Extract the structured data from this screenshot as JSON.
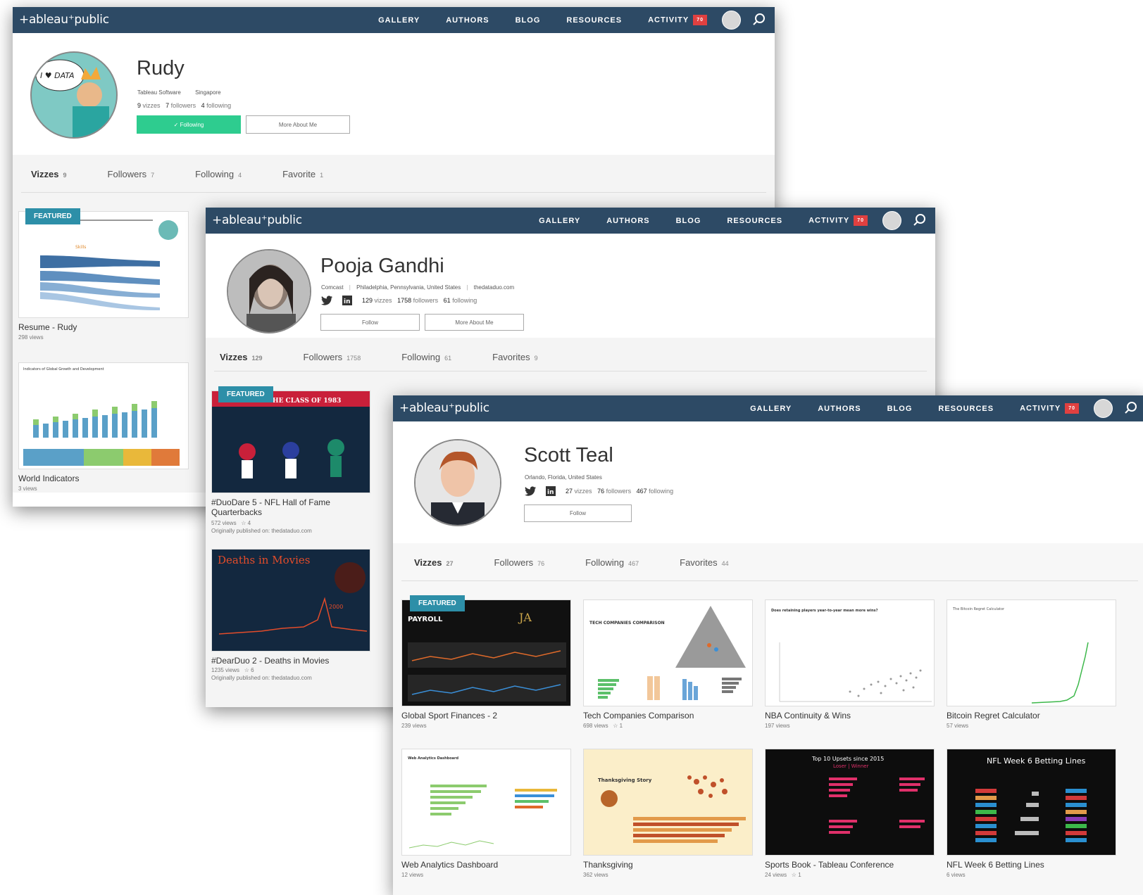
{
  "nav": {
    "logo": "+ableau⁺public",
    "links": [
      "GALLERY",
      "AUTHORS",
      "BLOG",
      "RESOURCES",
      "ACTIVITY"
    ],
    "badge": "70"
  },
  "windows": [
    {
      "profile": {
        "name": "Rudy",
        "org": "Tableau Software",
        "location": "Singapore",
        "vizzes_count": "9",
        "vizzes_label": "vizzes",
        "followers_count": "7",
        "followers_label": "followers",
        "following_count": "4",
        "following_label": "following",
        "follow_btn": "✓ Following",
        "more_btn": "More About Me"
      },
      "tabs": [
        {
          "label": "Vizzes",
          "count": "9"
        },
        {
          "label": "Followers",
          "count": "7"
        },
        {
          "label": "Following",
          "count": "4"
        },
        {
          "label": "Favorite",
          "count": "1"
        }
      ],
      "featured": "FEATURED",
      "cards": [
        {
          "title": "Resume - Rudy",
          "views": "298 views",
          "thumb_text": "Skills"
        },
        {
          "title": "World Indicators",
          "views": "3 views",
          "thumb_text": "Indicators of Global Growth and Development"
        }
      ]
    },
    {
      "profile": {
        "name": "Pooja Gandhi",
        "org": "Comcast",
        "location": "Philadelphia, Pennsylvania, United States",
        "website": "thedataduo.com",
        "vizzes_count": "129",
        "vizzes_label": "vizzes",
        "followers_count": "1758",
        "followers_label": "followers",
        "following_count": "61",
        "following_label": "following",
        "follow_btn": "Follow",
        "more_btn": "More About Me"
      },
      "tabs": [
        {
          "label": "Vizzes",
          "count": "129"
        },
        {
          "label": "Followers",
          "count": "1758"
        },
        {
          "label": "Following",
          "count": "61"
        },
        {
          "label": "Favorites",
          "count": "9"
        }
      ],
      "featured": "FEATURED",
      "cards": [
        {
          "title": "#DuoDare 5 - NFL Hall of Fame Quarterbacks",
          "title_line1": "#DuoDare 5 - NFL Hall of Fame",
          "title_line2": "Quarterbacks",
          "views": "572 views",
          "stars": "4",
          "orig": "Originally published on: thedataduo.com",
          "thumb_text": "OF THE CLASS OF 1983"
        },
        {
          "title": "#DearDuo 2 - Deaths in Movies",
          "views": "1235 views",
          "stars": "6",
          "orig": "Originally published on: thedataduo.com",
          "thumb_text": "Deaths in Movies",
          "thumb_num": "2000"
        }
      ]
    },
    {
      "profile": {
        "name": "Scott Teal",
        "location": "Orlando, Florida, United States",
        "vizzes_count": "27",
        "vizzes_label": "vizzes",
        "followers_count": "76",
        "followers_label": "followers",
        "following_count": "467",
        "following_label": "following",
        "follow_btn": "Follow"
      },
      "tabs": [
        {
          "label": "Vizzes",
          "count": "27"
        },
        {
          "label": "Followers",
          "count": "76"
        },
        {
          "label": "Following",
          "count": "467"
        },
        {
          "label": "Favorites",
          "count": "44"
        }
      ],
      "featured": "FEATURED",
      "cards": [
        {
          "title": "Global Sport Finances - 2",
          "views": "239 views",
          "thumb_text": "PAYROLL"
        },
        {
          "title": "Tech Companies Comparison",
          "views": "698 views",
          "stars": "1",
          "thumb_text": "TECH COMPANIES COMPARISON"
        },
        {
          "title": "NBA Continuity & Wins",
          "views": "197 views",
          "thumb_text": "Does retaining players year-to-year mean more wins?"
        },
        {
          "title": "Bitcoin Regret Calculator",
          "views": "57 views",
          "thumb_text": "The Bitcoin Regret Calculator"
        },
        {
          "title": "Web Analytics Dashboard",
          "views": "12 views",
          "thumb_text": "Web Analytics Dashboard"
        },
        {
          "title": "Thanksgiving",
          "views": "362 views",
          "thumb_text": "Thanksgiving Story"
        },
        {
          "title": "Sports Book - Tableau Conference",
          "views": "24 views",
          "stars": "1",
          "thumb_text": "Top 10 Upsets since 2015",
          "thumb_sub": "Loser | Winner"
        },
        {
          "title": "NFL Week 6 Betting Lines",
          "views": "6 views",
          "thumb_text": "NFL Week 6 Betting Lines"
        }
      ]
    }
  ]
}
